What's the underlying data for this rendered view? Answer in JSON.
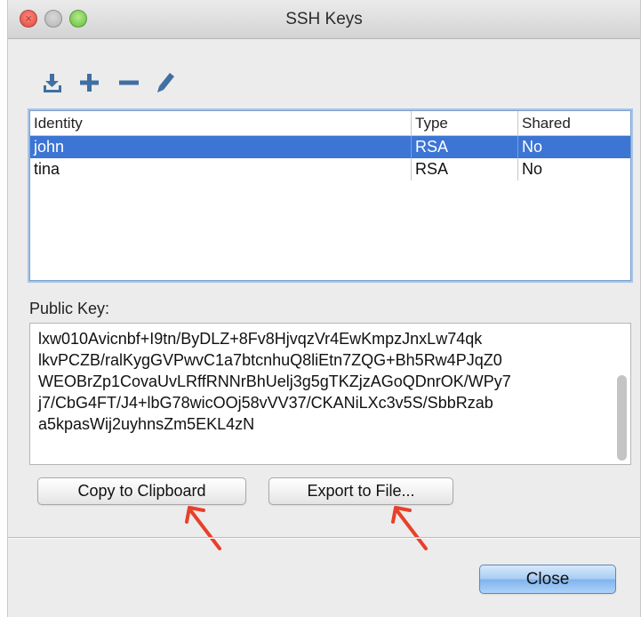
{
  "window": {
    "title": "SSH Keys"
  },
  "toolbar": {
    "items": [
      {
        "icon": "download-icon"
      },
      {
        "icon": "plus-icon"
      },
      {
        "icon": "minus-icon"
      },
      {
        "icon": "pencil-icon"
      }
    ]
  },
  "table": {
    "columns": [
      "Identity",
      "Type",
      "Shared"
    ],
    "rows": [
      {
        "identity": "john",
        "type": "RSA",
        "shared": "No",
        "selected": true
      },
      {
        "identity": "tina",
        "type": "RSA",
        "shared": "No",
        "selected": false
      }
    ]
  },
  "public_key": {
    "label": "Public Key:",
    "lines": [
      "lxw010Avicnbf+I9tn/ByDLZ+8Fv8HjvqzVr4EwKmpzJnxLw74qk",
      "lkvPCZB/ralKygGVPwvC1a7btcnhuQ8liEtn7ZQG+Bh5Rw4PJqZ0",
      "WEOBrZp1CovaUvLRffRNNrBhUelj3g5gTKZjzAGoQDnrOK/WPy7",
      "j7/CbG4FT/J4+lbG78wicOOj58vVV37/CKANiLXc3v5S/SbbRzab",
      "a5kpasWij2uyhnsZm5EKL4zN"
    ]
  },
  "buttons": {
    "copy": "Copy to Clipboard",
    "export": "Export to File...",
    "close": "Close"
  },
  "colors": {
    "selection": "#3c75d4",
    "annotation_arrow": "#e8402a",
    "close_button": "#8fbff3"
  }
}
